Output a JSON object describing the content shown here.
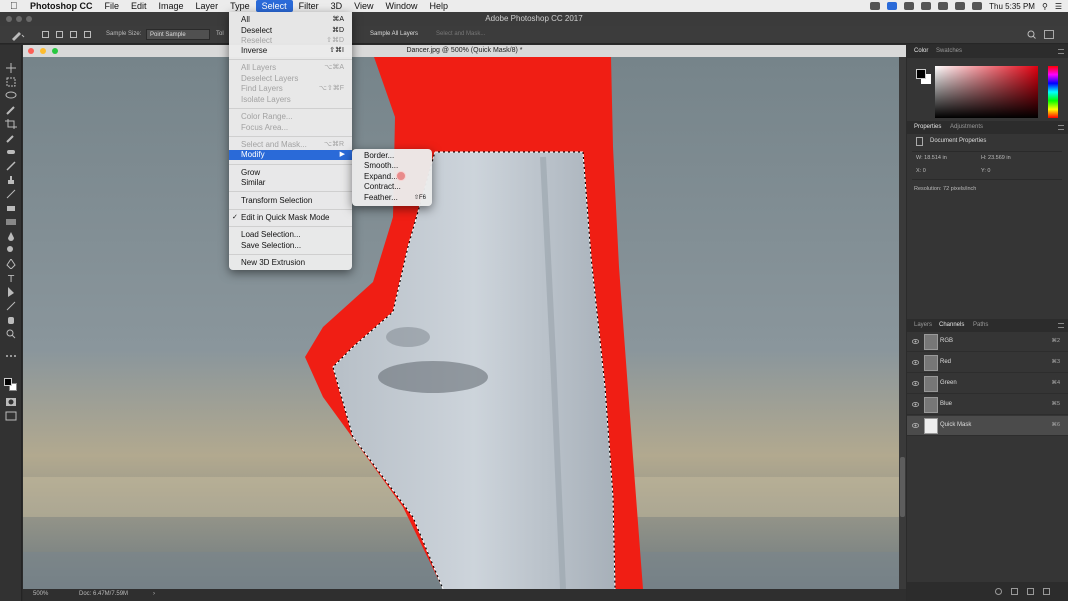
{
  "menubar": {
    "app_name": "Photoshop CC",
    "items": [
      "File",
      "Edit",
      "Image",
      "Layer",
      "Type",
      "Select",
      "Filter",
      "3D",
      "View",
      "Window",
      "Help"
    ],
    "active_item": "Select",
    "clock": "Thu 5:35 PM"
  },
  "window": {
    "title": "Adobe Photoshop CC 2017"
  },
  "options_bar": {
    "sample_size_label": "Sample Size:",
    "sample_size_value": "Point Sample",
    "tolerance_label": "Tol",
    "sample_all_layers": "Sample All Layers",
    "select_and_mask": "Select and Mask..."
  },
  "document": {
    "title": "Dancer.jpg @ 500% (Quick Mask/8) *",
    "zoom": "500%",
    "doc_info": "Doc: 6.47M/7.59M"
  },
  "select_menu": [
    {
      "label": "All",
      "shortcut": "⌘A",
      "enabled": true
    },
    {
      "label": "Deselect",
      "shortcut": "⌘D",
      "enabled": true
    },
    {
      "label": "Reselect",
      "shortcut": "⇧⌘D",
      "enabled": false
    },
    {
      "label": "Inverse",
      "shortcut": "⇧⌘I",
      "enabled": true
    },
    {
      "label": "All Layers",
      "shortcut": "⌥⌘A",
      "enabled": false
    },
    {
      "label": "Deselect Layers",
      "shortcut": "",
      "enabled": false
    },
    {
      "label": "Find Layers",
      "shortcut": "⌥⇧⌘F",
      "enabled": false
    },
    {
      "label": "Isolate Layers",
      "shortcut": "",
      "enabled": false
    },
    {
      "label": "Color Range...",
      "shortcut": "",
      "enabled": false
    },
    {
      "label": "Focus Area...",
      "shortcut": "",
      "enabled": false
    },
    {
      "label": "Select and Mask...",
      "shortcut": "⌥⌘R",
      "enabled": false
    },
    {
      "label": "Modify",
      "shortcut": "",
      "enabled": true,
      "highlighted": true,
      "submenu": true
    },
    {
      "label": "Grow",
      "shortcut": "",
      "enabled": true
    },
    {
      "label": "Similar",
      "shortcut": "",
      "enabled": true
    },
    {
      "label": "Transform Selection",
      "shortcut": "",
      "enabled": true
    },
    {
      "label": "Edit in Quick Mask Mode",
      "shortcut": "",
      "enabled": true,
      "checked": true
    },
    {
      "label": "Load Selection...",
      "shortcut": "",
      "enabled": true
    },
    {
      "label": "Save Selection...",
      "shortcut": "",
      "enabled": true
    },
    {
      "label": "New 3D Extrusion",
      "shortcut": "",
      "enabled": true
    }
  ],
  "modify_submenu": [
    {
      "label": "Border...",
      "shortcut": ""
    },
    {
      "label": "Smooth...",
      "shortcut": ""
    },
    {
      "label": "Expand...",
      "shortcut": ""
    },
    {
      "label": "Contract...",
      "shortcut": ""
    },
    {
      "label": "Feather...",
      "shortcut": "⇧F6"
    }
  ],
  "color_panel": {
    "tabs": [
      "Color",
      "Swatches"
    ],
    "accent": "#e00010"
  },
  "properties_panel": {
    "tabs": [
      "Properties",
      "Adjustments"
    ],
    "header": "Document Properties",
    "w": "W: 18.514 in",
    "h": "H: 23.569 in",
    "x": "X: 0",
    "y": "Y: 0",
    "resolution": "Resolution: 72 pixels/inch"
  },
  "channels_panel": {
    "tabs": [
      "Layers",
      "Channels",
      "Paths"
    ],
    "channels": [
      {
        "name": "RGB",
        "shortcut": "⌘2"
      },
      {
        "name": "Red",
        "shortcut": "⌘3"
      },
      {
        "name": "Green",
        "shortcut": "⌘4"
      },
      {
        "name": "Blue",
        "shortcut": "⌘5"
      },
      {
        "name": "Quick Mask",
        "shortcut": "⌘6"
      }
    ]
  }
}
